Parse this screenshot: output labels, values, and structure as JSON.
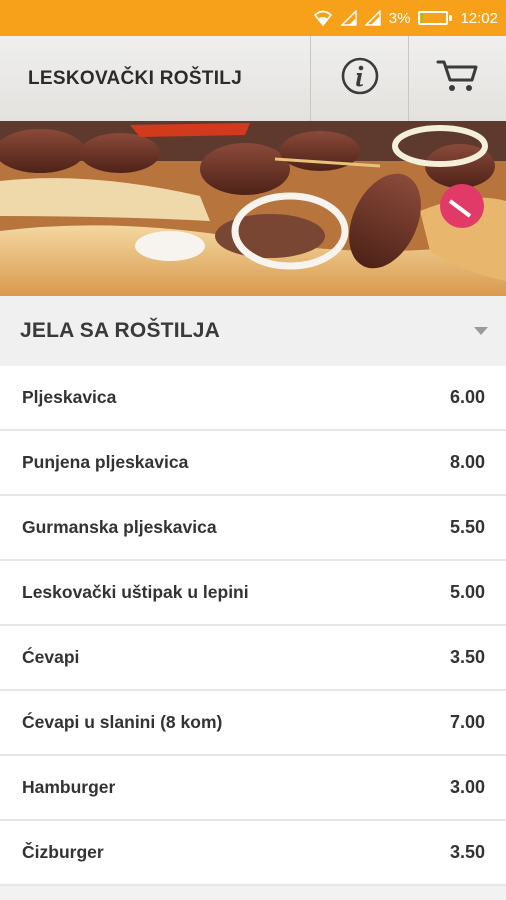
{
  "status_bar": {
    "battery_percent": "3%",
    "time": "12:02",
    "battery_level": 0.03,
    "icons": [
      "wifi-icon",
      "signal-icon",
      "signal-icon",
      "battery-icon"
    ]
  },
  "header": {
    "title": "LESKOVAČKI ROŠTILJ",
    "info_icon": "info-icon",
    "cart_icon": "cart-icon"
  },
  "banner": {
    "description_icon": "food-photo"
  },
  "category": {
    "title": "JELA SA ROŠTILJA",
    "dropdown_icon": "dropdown-arrow-icon"
  },
  "menu": {
    "items": [
      {
        "name": "Pljeskavica",
        "price": "6.00"
      },
      {
        "name": "Punjena pljeskavica",
        "price": "8.00"
      },
      {
        "name": "Gurmanska pljeskavica",
        "price": "5.50"
      },
      {
        "name": "Leskovački uštipak u lepini",
        "price": "5.00"
      },
      {
        "name": "Ćevapi",
        "price": "3.50"
      },
      {
        "name": "Ćevapi u slanini (8 kom)",
        "price": "7.00"
      },
      {
        "name": "Hamburger",
        "price": "3.00"
      },
      {
        "name": "Čizburger",
        "price": "3.50"
      }
    ]
  },
  "colors": {
    "status_bar": "#f7a11a",
    "battery_fill": "#7ed321",
    "text": "#333333"
  }
}
